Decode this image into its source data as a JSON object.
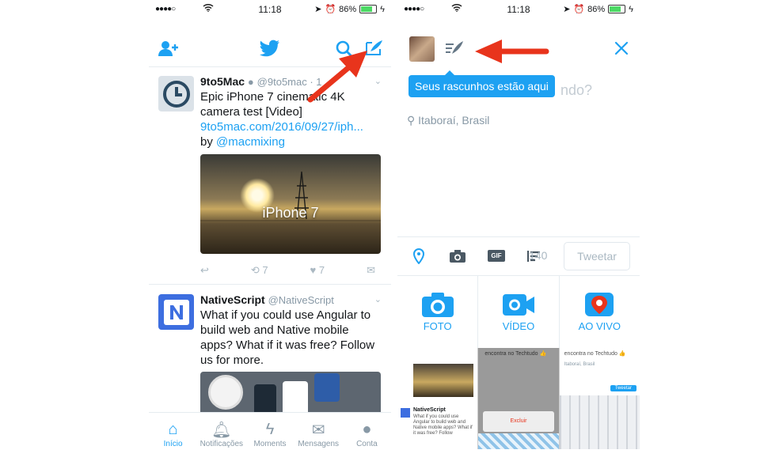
{
  "status": {
    "signal": "●●●●○",
    "time": "11:18",
    "battery": "86%"
  },
  "left": {
    "icons": {
      "follow": "add-user-icon",
      "logo": "twitter-bird-icon",
      "search": "search-icon",
      "compose": "compose-icon"
    },
    "tweets": [
      {
        "name": "9to5Mac",
        "handle": "@9to5mac · 1",
        "line1": "Epic iPhone 7 cinematic 4K",
        "line2": "camera test [Video]",
        "link": "9to5mac.com/2016/09/27/iph...",
        "by": "by",
        "mention": "@macmixing",
        "image_caption": "iPhone 7",
        "retweets": "7",
        "likes": "7"
      },
      {
        "name": "NativeScript",
        "handle": "@NativeScript",
        "line1": "What if you could use Angular to",
        "line2": "build web and Native mobile",
        "line3": "apps? What if it was free? Follow",
        "line4": "us for more."
      }
    ],
    "tabs": [
      {
        "label": "Início",
        "icon": "home-icon"
      },
      {
        "label": "Notificações",
        "icon": "bell-icon"
      },
      {
        "label": "Moments",
        "icon": "lightning-icon"
      },
      {
        "label": "Mensagens",
        "icon": "envelope-icon"
      },
      {
        "label": "Conta",
        "icon": "person-icon"
      }
    ]
  },
  "right": {
    "tooltip": "Seus rascunhos estão aqui",
    "prompt_tail": "ndo?",
    "location": "Itaboraí, Brasil",
    "char_count": "140",
    "tweet_button": "Tweetar",
    "gif_label": "GIF",
    "media": [
      {
        "label": "FOTO",
        "icon": "camera-icon"
      },
      {
        "label": "VÍDEO",
        "icon": "video-icon"
      },
      {
        "label": "AO VIVO",
        "icon": "periscope-icon"
      }
    ],
    "thumbs": {
      "t1_name": "NativeScript",
      "t1_text": "What if you could use Angular to build web and Native mobile apps? What if it was free? Follow",
      "t2_text": "encontra no Techtudo 👍",
      "t2_button": "Excluir",
      "t3_text": "encontra no Techtudo 👍",
      "t3_loc": "Itaboraí, Brasil",
      "t3_button": "Tweetar"
    }
  },
  "colors": {
    "accent": "#1da1f2",
    "arrow": "#e8341c"
  }
}
